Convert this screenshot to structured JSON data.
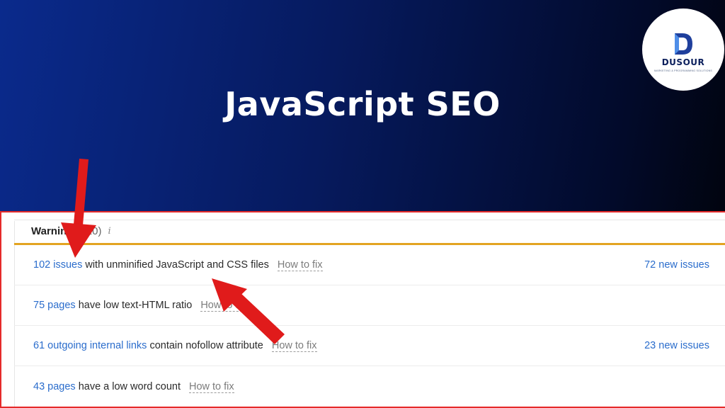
{
  "hero": {
    "title": "JavaScript SEO",
    "bg_colors": [
      "#0a2a8c",
      "#020a2a"
    ]
  },
  "logo": {
    "name": "DUSOUR",
    "tagline": "MARKETING & PROGRAMMING SOLUTIONS",
    "color": "#0b1f5c"
  },
  "warnings": {
    "title": "Warnings",
    "count": "(10)",
    "info_icon": "info-icon",
    "accent_color": "#e3a421",
    "how_to_fix": "How to fix",
    "rows": [
      {
        "link": "102 issues",
        "text": " with unminified JavaScript and CSS files",
        "new_issues": "72 new issues"
      },
      {
        "link": "75 pages",
        "text": " have low text-HTML ratio",
        "new_issues": ""
      },
      {
        "link": "61 outgoing internal links",
        "text": " contain nofollow attribute",
        "new_issues": "23 new issues"
      },
      {
        "link": "43 pages",
        "text": " have a low word count",
        "new_issues": ""
      }
    ]
  },
  "annotation": {
    "arrow_color": "#e01b1b",
    "arrows": [
      "arrow-down-icon",
      "arrow-up-left-icon"
    ]
  }
}
